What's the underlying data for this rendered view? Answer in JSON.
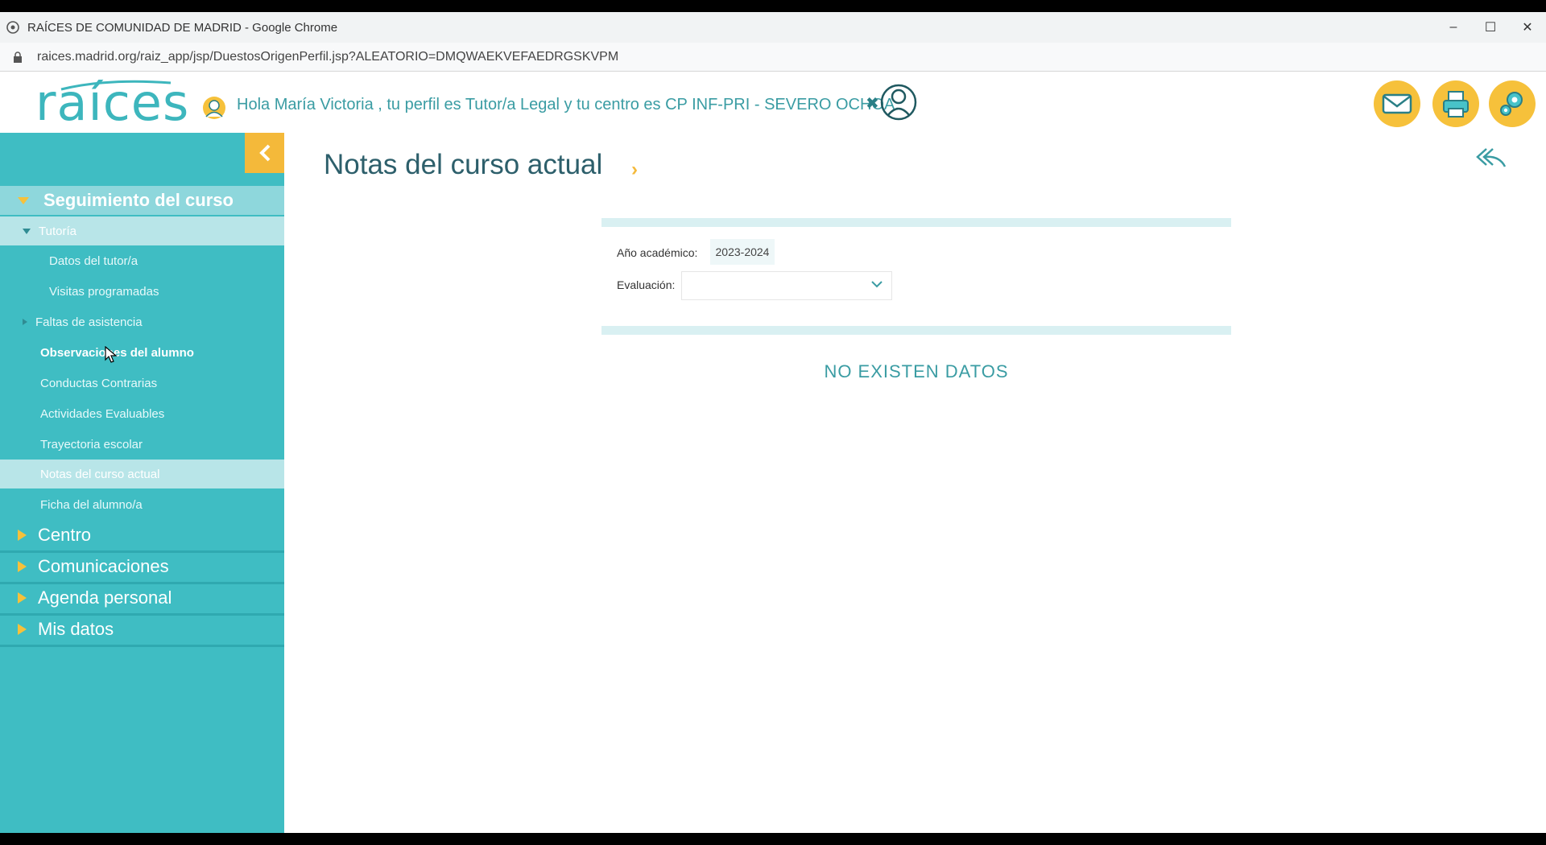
{
  "window": {
    "title": "RAÍCES DE COMUNIDAD DE MADRID - Google Chrome",
    "controls": [
      "–",
      "☐",
      "✕"
    ]
  },
  "address": {
    "url": "raices.madrid.org/raiz_app/jsp/DuestosOrigenPerfil.jsp?ALEATORIO=DMQWAEKVEFAEDRGSKVPM"
  },
  "header": {
    "logo": "raíces",
    "greeting": "Hola María Victoria , tu perfil es Tutor/a Legal y tu centro es CP INF-PRI - SEVERO OCHOA.",
    "icons": [
      "mail-icon",
      "printer-icon",
      "settings-icon"
    ]
  },
  "sidebar": {
    "section": "Seguimiento del curso",
    "subsection": "Tutoría",
    "tutoria_items": [
      "Datos del tutor/a",
      "Visitas programadas"
    ],
    "items": [
      "Faltas de asistencia",
      "Observaciones del alumno",
      "Conductas Contrarias",
      "Actividades Evaluables",
      "Trayectoria escolar",
      "Notas del curso actual",
      "Ficha del alumno/a"
    ],
    "main_items": [
      "Centro",
      "Comunicaciones",
      "Agenda personal",
      "Mis datos"
    ]
  },
  "main": {
    "title": "Notas del curso actual",
    "year_label": "Año académico:",
    "year_value": "2023-2024",
    "eval_label": "Evaluación:",
    "eval_value": "",
    "empty_message": "NO EXISTEN DATOS"
  },
  "colors": {
    "teal": "#3fbdc3",
    "teal_light": "#b8e5e8",
    "accent": "#f6c13b"
  }
}
